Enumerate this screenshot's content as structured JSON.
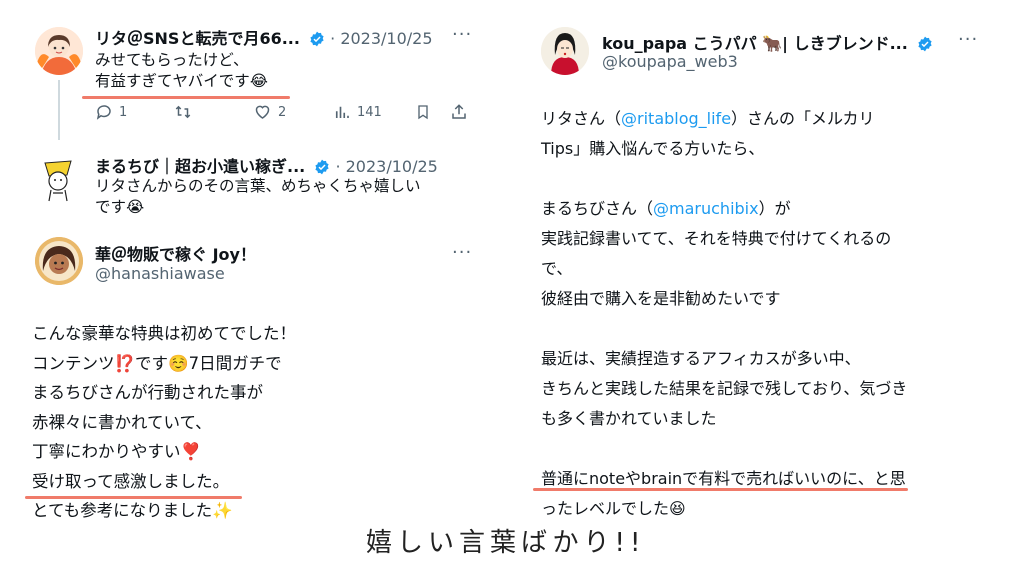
{
  "left": {
    "tweet1": {
      "author": "リタ＠SNSと転売で月66...",
      "date": "· 2023/10/25",
      "line1": "みせてもらったけど、",
      "line2": "有益すぎてヤバイです",
      "emoji": "😂",
      "actions": {
        "replies": "1",
        "retweets": "",
        "likes": "2",
        "views": "141"
      }
    },
    "tweet2": {
      "author": "まるちび｜超お小遣い稼ぎ...",
      "date": "· 2023/10/25",
      "line1": "リタさんからのその言葉、めちゃくちゃ嬉しい",
      "line2": "です",
      "emoji": "😭"
    },
    "tweet3": {
      "author": "華＠物販で稼ぐ Joy！",
      "handle": "@hanashiawase",
      "lines": [
        "こんな豪華な特典は初めてでした！",
        "コンテンツ",
        "です",
        "7日間ガチで",
        "まるちびさんが行動された事が",
        "赤裸々に書かれていて、",
        "丁寧にわかりやすい",
        "受け取って感激しました。",
        "とても参考になりました"
      ],
      "emojis": [
        "⁉️",
        "☺️",
        "❣️",
        "✨"
      ]
    }
  },
  "right": {
    "author": "kou_papa こうパパ 🐂| しきブレンド...",
    "handle": "@koupapa_web3",
    "p1": {
      "pre": "リタさん（",
      "mention": "@ritablog_life",
      "post": "）さんの「メルカリ",
      "line2": "Tips」購入悩んでる方いたら、"
    },
    "p2": {
      "pre": "まるちびさん（",
      "mention": "@maruchibix",
      "post": "）が",
      "line2": "実践記録書いてて、それを特典で付けてくれるの",
      "line3": "で、",
      "line4": "彼経由で購入を是非勧めたいです"
    },
    "p3": {
      "line1": "最近は、実績捏造するアフィカスが多い中、",
      "line2": "きちんと実践した結果を記録で残しており、気づき",
      "line3": "も多く書かれていました"
    },
    "p4": {
      "line1": "普通にnoteやbrainで有料で売ればいいのに、と思",
      "line2": "ったレベルでした",
      "emoji": "😆"
    }
  },
  "caption": "嬉しい言葉ばかり!!",
  "colors": {
    "accent_link": "#1d9bf0",
    "underline": "#f07b6a",
    "verified": "#1d9bf0",
    "muted": "#536471"
  }
}
